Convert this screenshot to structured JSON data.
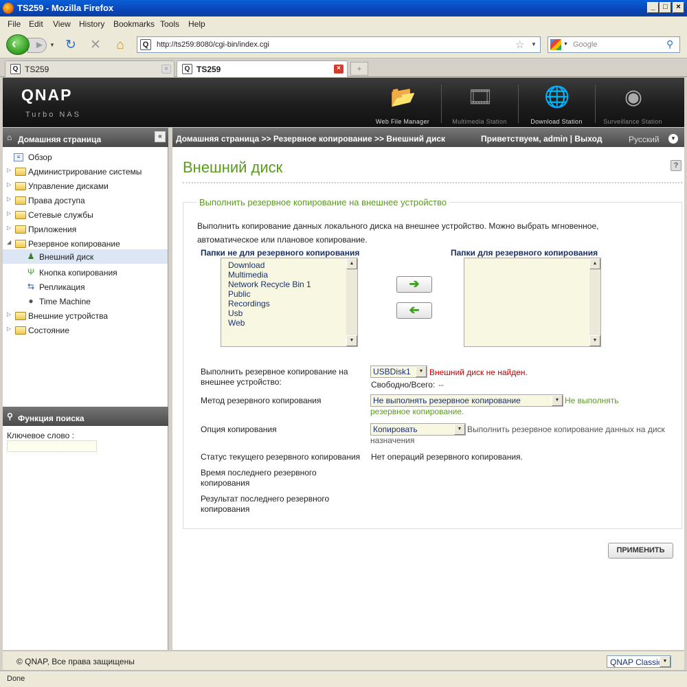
{
  "window": {
    "title": "TS259 - Mozilla Firefox"
  },
  "menu": [
    "File",
    "Edit",
    "View",
    "History",
    "Bookmarks",
    "Tools",
    "Help"
  ],
  "urlbar": {
    "url": "http://ts259:8080/cgi-bin/index.cgi",
    "search_placeholder": "Google"
  },
  "tabs": [
    {
      "label": "TS259"
    },
    {
      "label": "TS259"
    }
  ],
  "header": {
    "logo": "QNAP",
    "sublogo": "Turbo NAS",
    "apps": [
      {
        "label": "Web File Manager"
      },
      {
        "label": "Multimedia Station"
      },
      {
        "label": "Download Station"
      },
      {
        "label": "Surveillance Station"
      }
    ]
  },
  "sidebar": {
    "title": "Домашняя страница",
    "items": [
      {
        "label": "Обзор"
      },
      {
        "label": "Администрирование системы"
      },
      {
        "label": "Управление дисками"
      },
      {
        "label": "Права доступа"
      },
      {
        "label": "Сетевые службы"
      },
      {
        "label": "Приложения"
      },
      {
        "label": "Резервное копирование"
      },
      {
        "label": "Внешний диск"
      },
      {
        "label": "Кнопка копирования"
      },
      {
        "label": "Репликация"
      },
      {
        "label": "Time Machine"
      },
      {
        "label": "Внешние устройства"
      },
      {
        "label": "Состояние"
      }
    ],
    "search": {
      "title": "Функция поиска",
      "keyword_label": "Ключевое слово :"
    }
  },
  "breadcrumb": {
    "path": "Домашняя страница >> Резервное копирование >> Внешний диск",
    "welcome": "Приветствуем,  admin | Выход",
    "language": "Русский"
  },
  "page": {
    "title": "Внешний диск",
    "section_title": "Выполнить резервное копирование на внешнее устройство",
    "description": "Выполнить копирование данных локального диска на внешнее устройство. Можно выбрать мгновенное, автоматическое или плановое копирование.",
    "left_list_title": "Папки не для резервного копирования",
    "right_list_title": "Папки для резервного копирования",
    "left_folders": [
      "Download",
      "Multimedia",
      "Network Recycle Bin 1",
      "Public",
      "Recordings",
      "Usb",
      "Web"
    ],
    "right_folders": [],
    "fields": {
      "device_label": "Выполнить резервное копирование на внешнее устройство:",
      "device_value": "USBDisk1",
      "device_status": "Внешний диск не найден.",
      "free_total_label": "Свободно/Всего:",
      "free_total_value": "--",
      "method_label": "Метод резервного копирования",
      "method_value": "Не выполнять резервное копирование",
      "method_note": "Не выполнять резервное копирование.",
      "option_label": "Опция копирования",
      "option_value": "Копировать",
      "option_note": "Выполнить резервное копирование данных на диск назначения",
      "status_label": "Статус текущего резервного копирования",
      "status_value": "Нет операций резервного копирования.",
      "last_time_label": "Время последнего резервного копирования",
      "last_result_label": "Результат последнего резервного копирования"
    },
    "apply_label": "ПРИМЕНИТЬ"
  },
  "footer": {
    "copyright": "© QNAP, Все права защищены",
    "theme": "QNAP Classic"
  },
  "statusbar": {
    "text": "Done"
  }
}
